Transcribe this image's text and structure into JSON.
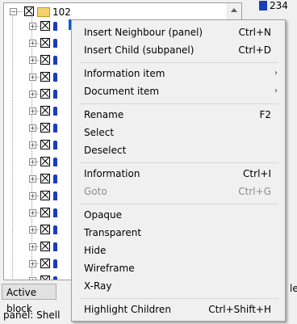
{
  "tree": {
    "root_label": "102",
    "child_count": 16
  },
  "side": {
    "badge_value": "234",
    "edge_text": "lec"
  },
  "bottom": {
    "active_block_label": "Active block",
    "status_text": "panel: Shell"
  },
  "menu": {
    "items": [
      {
        "label": "Insert Neighbour (panel)",
        "shortcut": "Ctrl+N"
      },
      {
        "label": "Insert Child (subpanel)",
        "shortcut": "Ctrl+D"
      },
      {
        "label": "Information item",
        "submenu": "›"
      },
      {
        "label": "Document item",
        "submenu": "›"
      },
      {
        "label": "Rename",
        "shortcut": "F2"
      },
      {
        "label": "Select"
      },
      {
        "label": "Deselect"
      },
      {
        "label": "Information",
        "shortcut": "Ctrl+I"
      },
      {
        "label": "Goto",
        "shortcut": "Ctrl+G",
        "disabled": true
      },
      {
        "label": "Opaque"
      },
      {
        "label": "Transparent"
      },
      {
        "label": "Hide"
      },
      {
        "label": "Wireframe"
      },
      {
        "label": "X-Ray"
      },
      {
        "label": "Highlight Children",
        "shortcut": "Ctrl+Shift+H"
      }
    ]
  }
}
